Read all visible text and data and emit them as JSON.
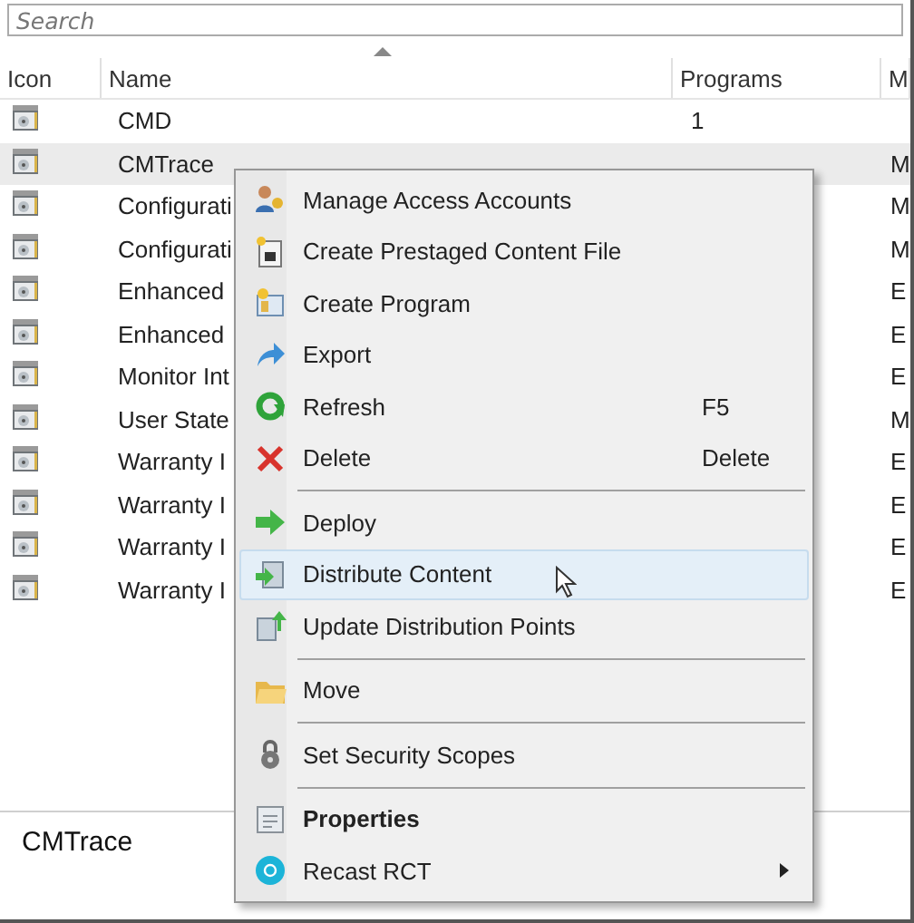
{
  "search": {
    "placeholder": "Search"
  },
  "table": {
    "columns": [
      "Icon",
      "Name",
      "Programs",
      "M"
    ],
    "rows": [
      {
        "name": "CMD",
        "programs": "1",
        "column_4": "",
        "selected": false
      },
      {
        "name": "CMTrace",
        "programs": "",
        "column_4": "M",
        "selected": true
      },
      {
        "name": "Configurati",
        "programs": "",
        "column_4": "M",
        "selected": false
      },
      {
        "name": "Configurati",
        "programs": "",
        "column_4": "M",
        "selected": false
      },
      {
        "name": "Enhanced",
        "programs": "",
        "column_4": "E",
        "selected": false
      },
      {
        "name": "Enhanced",
        "programs": "",
        "column_4": "E",
        "selected": false
      },
      {
        "name": "Monitor Int",
        "programs": "",
        "column_4": "E",
        "selected": false
      },
      {
        "name": "User State",
        "programs": "",
        "column_4": "M",
        "selected": false
      },
      {
        "name": "Warranty I",
        "programs": "",
        "column_4": "E",
        "selected": false
      },
      {
        "name": "Warranty I",
        "programs": "",
        "column_4": "E",
        "selected": false
      },
      {
        "name": "Warranty I",
        "programs": "",
        "column_4": "E",
        "selected": false
      },
      {
        "name": "Warranty I",
        "programs": "",
        "column_4": "E",
        "selected": false
      }
    ]
  },
  "context_menu": {
    "items": [
      {
        "kind": "item",
        "label": "Manage Access Accounts",
        "selected": false
      },
      {
        "kind": "item",
        "label": "Create Prestaged Content File",
        "selected": false
      },
      {
        "kind": "item",
        "label": "Create Program",
        "selected": false
      },
      {
        "kind": "item",
        "label": "Export",
        "selected": false
      },
      {
        "kind": "item",
        "label": "Refresh",
        "shortcut": "F5",
        "selected": false
      },
      {
        "kind": "item",
        "label": "Delete",
        "shortcut": "Delete",
        "selected": false
      },
      {
        "kind": "separator"
      },
      {
        "kind": "item",
        "label": "Deploy",
        "selected": false
      },
      {
        "kind": "item",
        "label": "Distribute Content",
        "selected": true
      },
      {
        "kind": "item",
        "label": "Update Distribution Points",
        "selected": false
      },
      {
        "kind": "separator"
      },
      {
        "kind": "item",
        "label": "Move",
        "selected": false
      },
      {
        "kind": "separator"
      },
      {
        "kind": "item",
        "label": "Set Security Scopes",
        "selected": false
      },
      {
        "kind": "separator"
      },
      {
        "kind": "item",
        "label": "Properties",
        "bold": true,
        "selected": false
      },
      {
        "kind": "item",
        "label": "Recast RCT",
        "submenu": true,
        "selected": false
      }
    ]
  },
  "details": {
    "title": "CMTrace"
  }
}
